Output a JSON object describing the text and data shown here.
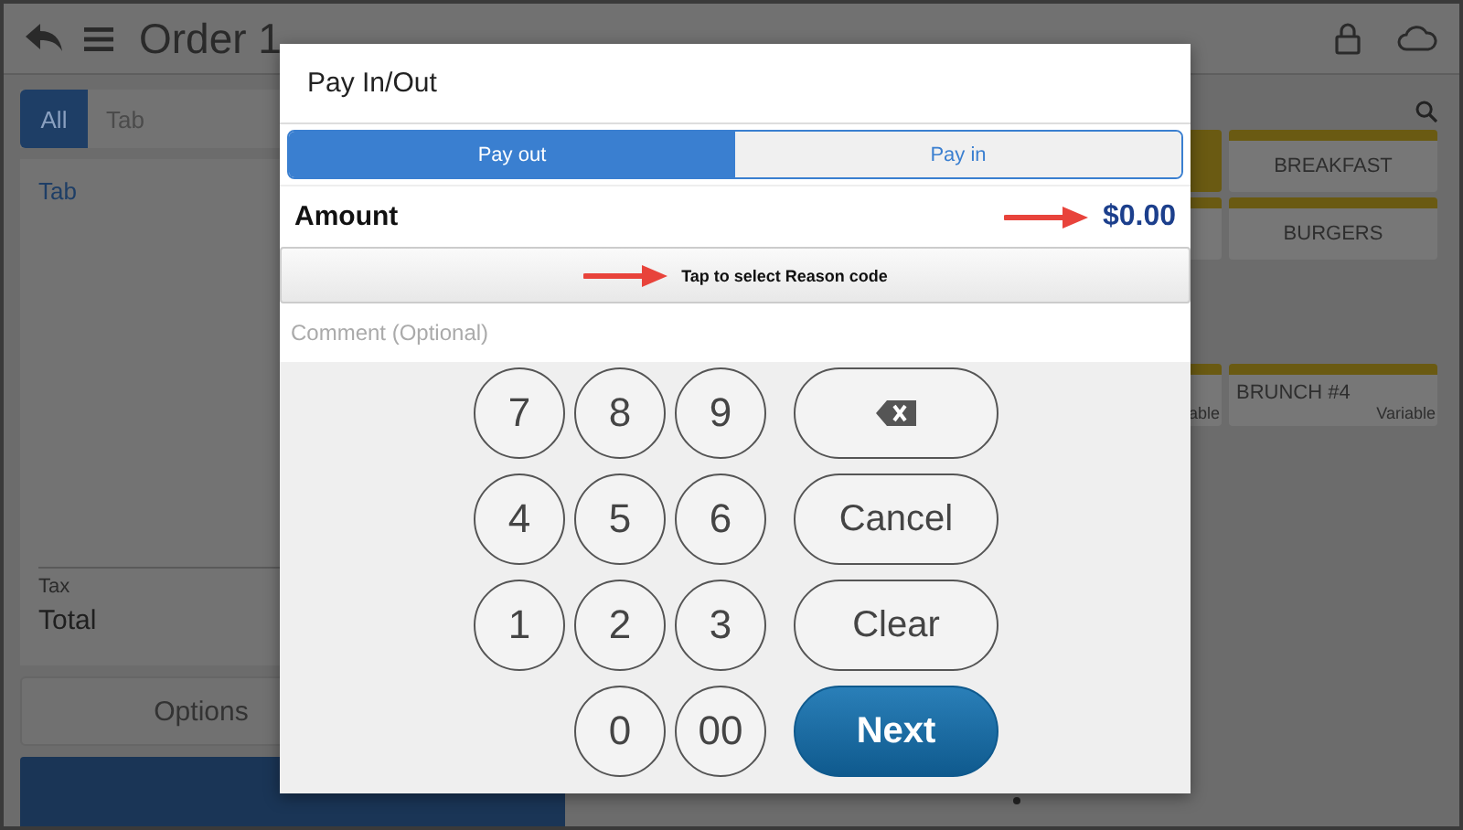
{
  "app_bar": {
    "title": "Order 1"
  },
  "left_panel": {
    "tabs": [
      {
        "label": "All",
        "selected": true
      },
      {
        "label": "Tab",
        "selected": false
      }
    ],
    "order_items": [
      "Tab"
    ],
    "tax_label": "Tax",
    "total_label": "Total",
    "options_button": "Options"
  },
  "menu_tiles": [
    {
      "kind": "filled"
    },
    {
      "kind": "plain",
      "label": "BREAKFAST"
    },
    {
      "kind": "plain"
    },
    {
      "kind": "plain",
      "label": "BURGERS"
    },
    {
      "kind": "plain",
      "price": "able"
    },
    {
      "kind": "plain",
      "label": "BRUNCH #4",
      "price": "Variable"
    }
  ],
  "dialog": {
    "title": "Pay In/Out",
    "segments": [
      {
        "label": "Pay out",
        "selected": true
      },
      {
        "label": "Pay in",
        "selected": false
      }
    ],
    "amount_label": "Amount",
    "amount_value": "$0.00",
    "reason_button": "Tap to select Reason code",
    "comment": {
      "placeholder": "Comment (Optional)"
    },
    "keys": [
      "7",
      "8",
      "9",
      "4",
      "5",
      "6",
      "1",
      "2",
      "3",
      "0",
      "00"
    ],
    "actions": [
      {
        "kind": "backspace"
      },
      {
        "kind": "text",
        "label": "Cancel"
      },
      {
        "kind": "text",
        "label": "Clear"
      },
      {
        "kind": "primary",
        "label": "Next"
      }
    ]
  }
}
